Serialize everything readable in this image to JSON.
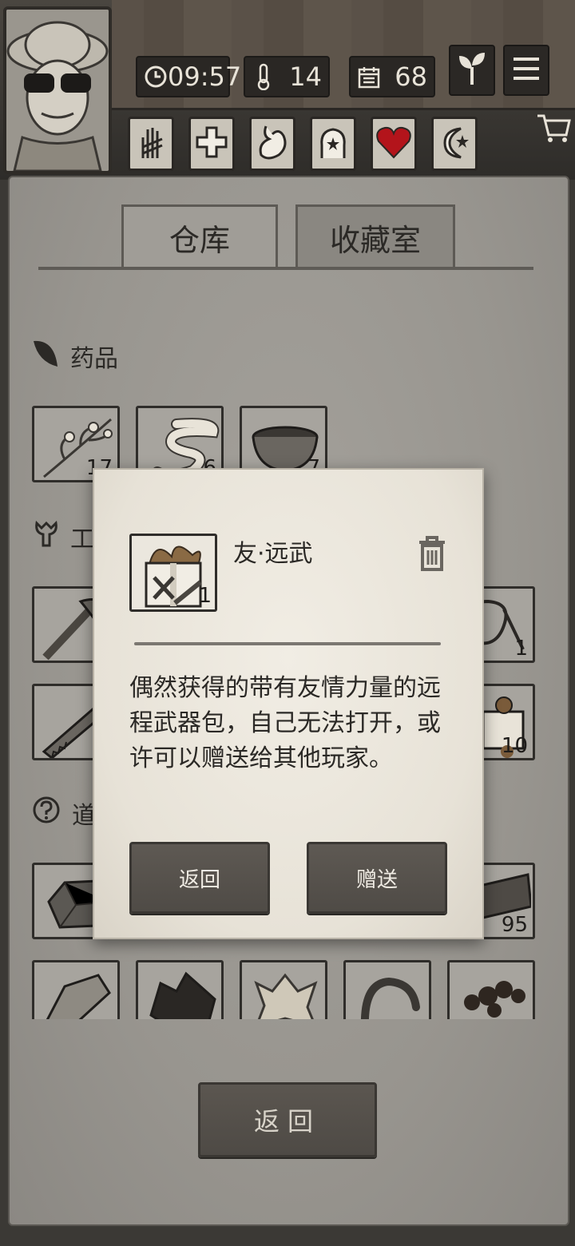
{
  "hud": {
    "time": "09:57",
    "temperature": "14",
    "days": "68",
    "icons": [
      "clock-icon",
      "thermometer-icon",
      "calendar-icon",
      "sprout-icon",
      "menu-icon",
      "cart-icon"
    ],
    "category_tabs": [
      "hand-icon",
      "plus-icon",
      "stomach-icon",
      "head-icon",
      "heart-icon",
      "moon-icon"
    ]
  },
  "tabs": {
    "warehouse": "仓库",
    "collection": "收藏室"
  },
  "sections": {
    "medicine": "药品",
    "tools": "工",
    "items": "道"
  },
  "medicine_slots": [
    {
      "icon": "herb-icon",
      "qty": "17"
    },
    {
      "icon": "bandage-icon",
      "qty": "6"
    },
    {
      "icon": "bowl-icon",
      "qty": "7"
    }
  ],
  "tool_slots": [
    {
      "icon": "axe-icon",
      "qty": ""
    },
    {
      "icon": "rope-icon",
      "qty": "1"
    },
    {
      "icon": "saw-icon",
      "qty": ""
    },
    {
      "icon": "gift-box-icon",
      "qty": "10"
    }
  ],
  "item_slots": [
    {
      "icon": "stone-icon",
      "qty": ""
    },
    {
      "icon": "plank-icon",
      "qty": "95"
    },
    {
      "icon": "rock-icon",
      "qty": ""
    },
    {
      "icon": "coal-icon",
      "qty": ""
    },
    {
      "icon": "hide-icon",
      "qty": ""
    },
    {
      "icon": "worm-icon",
      "qty": ""
    },
    {
      "icon": "berries-icon",
      "qty": ""
    }
  ],
  "modal": {
    "title": "友·远武",
    "qty": "1",
    "description": "偶然获得的带有友情力量的远程武器包，自己无法打开，或许可以赠送给其他玩家。",
    "return_label": "返回",
    "gift_label": "赠送"
  },
  "footer": {
    "back_label": "返回"
  },
  "colors": {
    "paper": "#a19e98",
    "dark_wood": "#4f4b46",
    "heart_red": "#b3141b"
  }
}
